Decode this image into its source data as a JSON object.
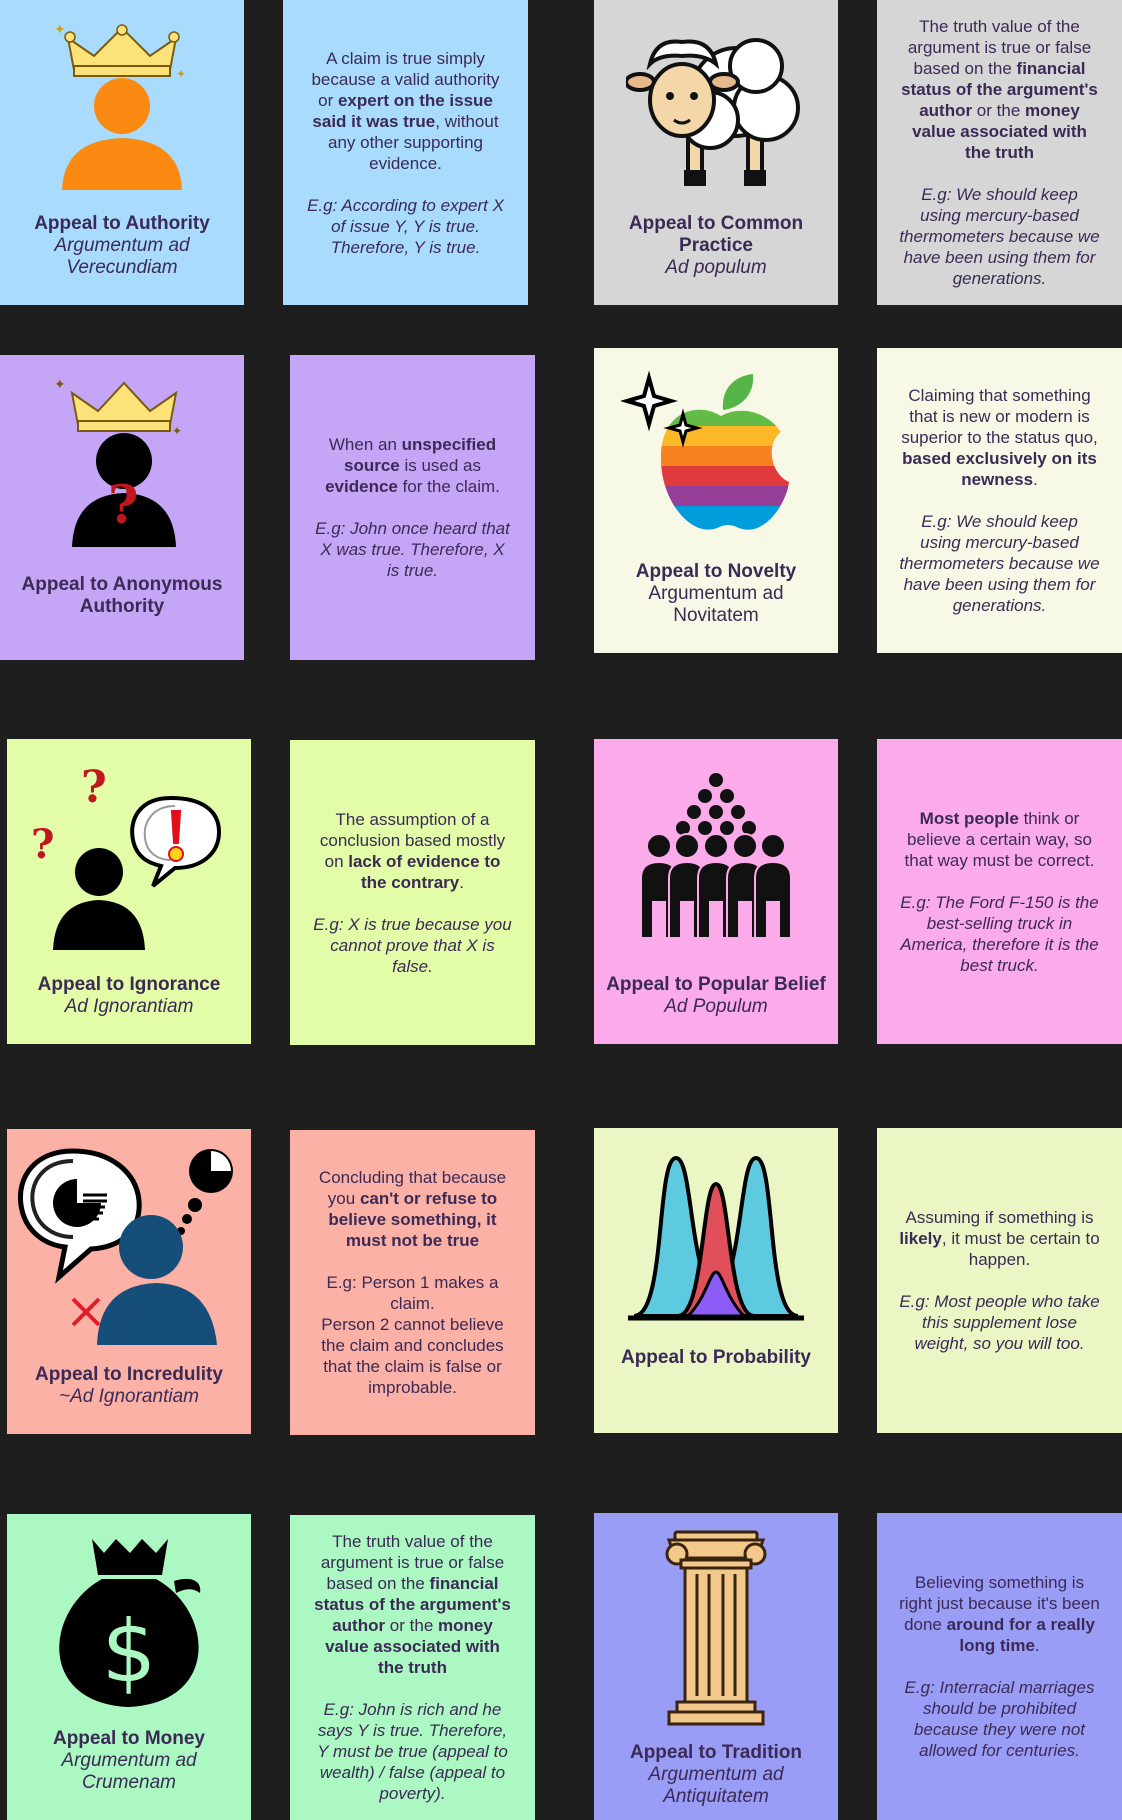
{
  "colors": {
    "background": "#1e1e1e",
    "authority": "#a9dcfc",
    "common_practice": "#d6d6d6",
    "anonymous": "#c5a6f6",
    "novelty": "#f7f9e6",
    "ignorance": "#e2fca8",
    "popular": "#fbaaea",
    "incredulity": "#fbb1a5",
    "probability": "#eaf7c5",
    "money": "#acf8c2",
    "tradition": "#9a9df5",
    "text": "#3b2a55"
  },
  "cards": {
    "authority": {
      "icon": "crowned-person-icon",
      "title": "Appeal to Authority",
      "subtitle": "Argumentum ad Verecundiam",
      "desc": [
        {
          "t": "A claim is true simply because a valid authority or "
        },
        {
          "t": "expert on the issue said it was true",
          "b": true
        },
        {
          "t": ", without any other supporting evidence."
        }
      ],
      "example": "E.g: According to expert X of issue Y, Y is true. Therefore, Y is true."
    },
    "common_practice": {
      "icon": "sheep-icon",
      "title": "Appeal to Common Practice",
      "subtitle": "Ad populum",
      "desc": [
        {
          "t": "The truth value of the argument is true or false based on the "
        },
        {
          "t": "financial status of the argument's author",
          "b": true
        },
        {
          "t": " or the "
        },
        {
          "t": "money value associated with the truth",
          "b": true
        }
      ],
      "example": "E.g: We should keep using mercury-based thermometers because we have been using them for generations."
    },
    "anonymous": {
      "icon": "anonymous-crowned-person-icon",
      "title": "Appeal to Anonymous Authority",
      "subtitle": "",
      "desc": [
        {
          "t": "When an "
        },
        {
          "t": "unspecified source",
          "b": true
        },
        {
          "t": " is used as "
        },
        {
          "t": "evidence",
          "b": true
        },
        {
          "t": " for the claim."
        }
      ],
      "example": "E.g: John once heard that X was true. Therefore, X is true."
    },
    "novelty": {
      "icon": "rainbow-apple-icon",
      "title": "Appeal to Novelty",
      "subtitle": "Argumentum ad Novitatem",
      "desc": [
        {
          "t": "Claiming that something that is new or modern is superior to the status quo, "
        },
        {
          "t": "based exclusively on its newness",
          "b": true
        },
        {
          "t": "."
        }
      ],
      "example": "E.g: We should keep using mercury-based thermometers because we have been using them for generations."
    },
    "ignorance": {
      "icon": "confused-person-icon",
      "title": "Appeal to Ignorance",
      "subtitle": "Ad Ignorantiam",
      "desc": [
        {
          "t": "The assumption of a conclusion based mostly on "
        },
        {
          "t": "lack of evidence to the contrary",
          "b": true
        },
        {
          "t": "."
        }
      ],
      "example": "E.g: X is true because you cannot prove that X is false."
    },
    "popular": {
      "icon": "crowd-pyramid-icon",
      "title": "Appeal to Popular Belief",
      "subtitle": "Ad Populum",
      "desc": [
        {
          "t": "Most people",
          "b": true
        },
        {
          "t": " think or believe a certain way, so that way must be correct."
        }
      ],
      "example": "E.g: The Ford F-150 is the best-selling truck in America, therefore it is the best truck."
    },
    "incredulity": {
      "icon": "doubting-person-icon",
      "title": "Appeal to Incredulity",
      "subtitle": "~Ad Ignorantiam",
      "desc": [
        {
          "t": "Concluding that because you "
        },
        {
          "t": "can't or refuse to believe something, it must not be true",
          "b": true
        }
      ],
      "example": "E.g: Person 1 makes a claim.\nPerson 2 cannot believe the claim and concludes that the claim is false or improbable."
    },
    "probability": {
      "icon": "bell-curves-icon",
      "title": "Appeal to Probability",
      "subtitle": "",
      "desc": [
        {
          "t": "Assuming if something is "
        },
        {
          "t": "likely",
          "b": true
        },
        {
          "t": ", it must be certain to happen."
        }
      ],
      "example": "E.g: Most people who take this supplement lose weight, so you will too."
    },
    "money": {
      "icon": "money-bag-icon",
      "title": "Appeal to Money",
      "subtitle": "Argumentum ad Crumenam",
      "desc": [
        {
          "t": "The truth value of the argument is true or false based on the "
        },
        {
          "t": "financial status of the argument's author",
          "b": true
        },
        {
          "t": " or the "
        },
        {
          "t": "money value associated with the truth",
          "b": true
        }
      ],
      "example": "E.g: John is rich and he says Y is true. Therefore, Y must be true (appeal to wealth) / false (appeal to poverty)."
    },
    "tradition": {
      "icon": "greek-column-icon",
      "title": "Appeal to Tradition",
      "subtitle": "Argumentum ad Antiquitatem",
      "desc": [
        {
          "t": "Believing something is right just because it's been done "
        },
        {
          "t": "around for a really long time",
          "b": true
        },
        {
          "t": "."
        }
      ],
      "example": "E.g: Interracial marriages should be prohibited because they were not allowed for centuries."
    }
  }
}
